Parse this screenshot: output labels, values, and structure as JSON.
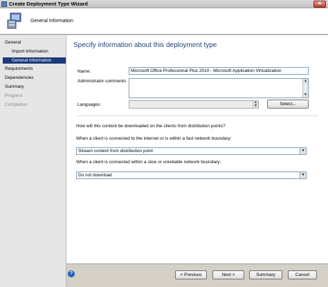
{
  "window": {
    "title": "Create Deployment Type Wizard",
    "close_glyph": "✕"
  },
  "header": {
    "page_name": "General Information"
  },
  "sidebar": {
    "items": [
      {
        "label": "General",
        "state": "normal"
      },
      {
        "label": "Import Information",
        "state": "normal"
      },
      {
        "label": "General Information",
        "state": "selected"
      },
      {
        "label": "Requirements",
        "state": "normal"
      },
      {
        "label": "Dependencies",
        "state": "normal"
      },
      {
        "label": "Summary",
        "state": "normal"
      },
      {
        "label": "Progress",
        "state": "disabled"
      },
      {
        "label": "Completion",
        "state": "disabled"
      }
    ]
  },
  "content": {
    "heading": "Specify information about this deployment type",
    "name_label": "Name:",
    "name_value": "Microsoft Office Professional Plus 2010 - Microsoft Application Virtualization",
    "admin_comments_label": "Administrator comments",
    "admin_comments_value": "",
    "languages_label": "Languages:",
    "languages_value": "",
    "select_button": "Select...",
    "download_question": "How will this content be downloaded on the clients from distribution points?",
    "fast_label": "When a client is connected to the internet or is within a fast network boundary:",
    "fast_value": "Stream content from distribution point",
    "slow_label": "When a client is connected within a slow or unreliable network boundary:",
    "slow_value": "Do not download"
  },
  "footer": {
    "previous": "< Previous",
    "next": "Next >",
    "summary": "Summary",
    "cancel": "Cancel"
  },
  "colors": {
    "accent": "#1a3a7a",
    "heading": "#1f3f7f",
    "sidebar_bg": "#e6e6e6"
  }
}
